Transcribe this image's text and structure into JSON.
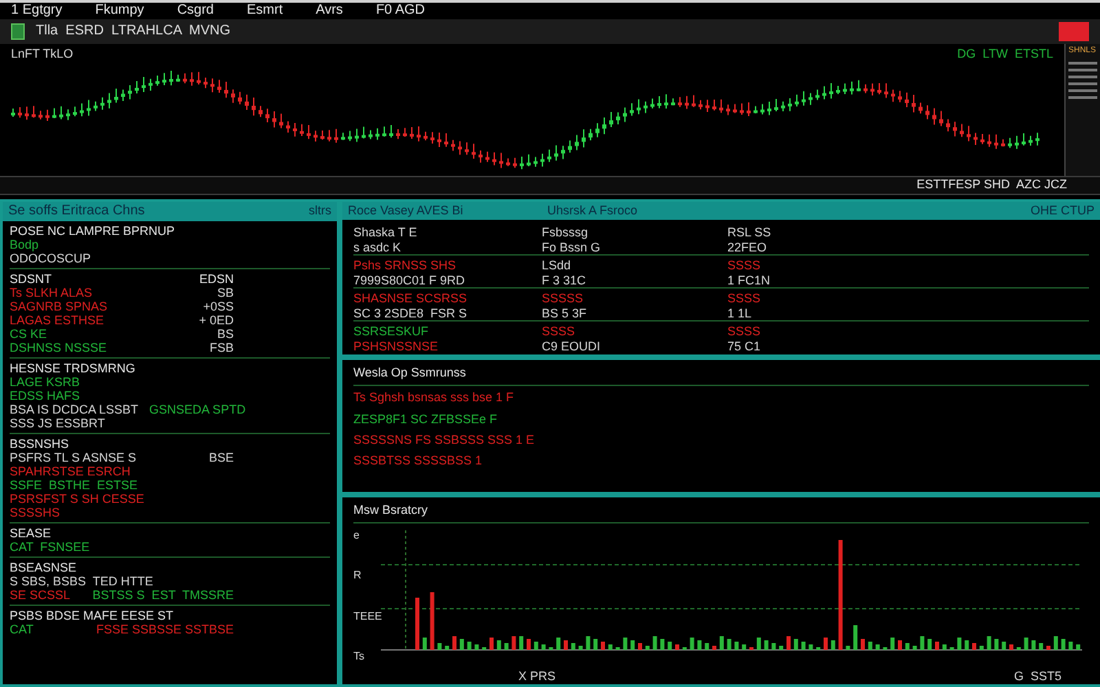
{
  "menu_bar": {
    "items": [
      "1 Egtgry",
      "Fkumpy",
      "Csgrd",
      "Esmrt",
      "Avrs",
      "F0 AGD"
    ]
  },
  "toolbar": {
    "title": "Tlla  ESRD  LTRAHLCA  MVNG"
  },
  "price_chart": {
    "label": "LnFT TkLO",
    "readout": "DG  LTW  ETSTL",
    "footer": "ESTTFESP SHD  AZC JCZ",
    "side_title": "SHNLS"
  },
  "left_panel": {
    "title": "Se soffs Eritraca Chns",
    "badge": "sltrs",
    "sections": [
      {
        "heading": "POSE NC LAMPRE BPRNUP",
        "rows": [
          {
            "cells": [
              {
                "text": "Bodp",
                "color": "#22b83a"
              }
            ]
          },
          {
            "cells": [
              {
                "text": "ODOCOSCUP",
                "color": "#d8d8d8"
              }
            ]
          }
        ]
      },
      {
        "heading": "SDSNT",
        "heading_right": "EDSN",
        "rows": [
          {
            "cells": [
              {
                "text": "Ts SLKH ALAS",
                "color": "#e02020"
              },
              {
                "text": "SB",
                "color": "#d8d8d8"
              }
            ]
          },
          {
            "cells": [
              {
                "text": "SAGNRB SPNAS",
                "color": "#e02020"
              },
              {
                "text": "+0SS",
                "color": "#d8d8d8"
              }
            ]
          },
          {
            "cells": [
              {
                "text": "LAGAS ESTHSE",
                "color": "#e02020"
              },
              {
                "text": "+ 0ED",
                "color": "#d8d8d8"
              }
            ]
          },
          {
            "cells": [
              {
                "text": "CS KE",
                "color": "#22b83a"
              },
              {
                "text": "BS",
                "color": "#d8d8d8"
              }
            ]
          },
          {
            "cells": [
              {
                "text": "DSHNSS NSSSE",
                "color": "#22b83a"
              },
              {
                "text": "FSB",
                "color": "#d8d8d8"
              }
            ]
          }
        ]
      },
      {
        "heading": "HESNSE TRDSMRNG",
        "rows": [
          {
            "cells": [
              {
                "text": "LAGE KSRB",
                "color": "#22b83a"
              }
            ]
          },
          {
            "cells": [
              {
                "text": "EDSS HAFS",
                "color": "#22b83a"
              }
            ]
          },
          {
            "cells": [
              {
                "text": "BSA IS DCDCA LSSBT",
                "color": "#d8d8d8"
              },
              {
                "text": "GSNSEDA SPTD",
                "color": "#22b83a"
              }
            ]
          },
          {
            "cells": [
              {
                "text": "SSS JS ESSBRT",
                "color": "#d8d8d8"
              }
            ]
          }
        ]
      },
      {
        "heading": "BSSNSHS",
        "rows": [
          {
            "cells": [
              {
                "text": "PSFRS TL S ASNSE S",
                "color": "#d8d8d8"
              },
              {
                "text": "BSE",
                "color": "#d8d8d8"
              }
            ]
          },
          {
            "cells": [
              {
                "text": "SPAHRSTSE ESRCH",
                "color": "#e02020"
              }
            ]
          },
          {
            "cells": [
              {
                "text": "SSFE  BSTHE  ESTSE",
                "color": "#22b83a"
              }
            ]
          },
          {
            "cells": [
              {
                "text": "PSRSFST S SH CESSE",
                "color": "#e02020"
              }
            ]
          },
          {
            "cells": [
              {
                "text": "SSSSHS",
                "color": "#e02020"
              }
            ]
          }
        ]
      },
      {
        "heading": "SEASE",
        "rows": [
          {
            "cells": [
              {
                "text": "CAT  FSNSEE",
                "color": "#22b83a"
              }
            ]
          }
        ]
      },
      {
        "heading": "BSEASNSE",
        "rows": [
          {
            "cells": [
              {
                "text": "S SBS, BSBS  TED HTTE",
                "color": "#d8d8d8"
              }
            ]
          },
          {
            "cells": [
              {
                "text": "SE SCSSL",
                "color": "#e02020"
              },
              {
                "text": "BSTSS S  EST  TMSSRE",
                "color": "#22b83a"
              }
            ]
          }
        ]
      },
      {
        "heading": "PSBS BDSE MAFE  EESE  ST",
        "rows": [
          {
            "cells": [
              {
                "text": "CAT",
                "color": "#22b83a"
              },
              {
                "text": "FSSE SSBSSE SSTBSE",
                "color": "#e02020"
              }
            ]
          }
        ]
      }
    ]
  },
  "quotes_panel": {
    "titles": [
      "Roce Vasey  AVES Bi",
      "Uhsrsk A Fsroco"
    ],
    "badge": "OHE CTUP",
    "rows": [
      {
        "cells": [
          {
            "text": "Shaska T E",
            "color": "#d8d8d8"
          },
          {
            "text": "Fsbsssg",
            "color": "#d8d8d8"
          },
          {
            "text": "RSL SS",
            "color": "#d8d8d8"
          }
        ]
      },
      {
        "cells": [
          {
            "text": "s asdc K",
            "color": "#d8d8d8"
          },
          {
            "text": "Fo Bssn G",
            "color": "#d8d8d8"
          },
          {
            "text": "22FEO",
            "color": "#d8d8d8"
          }
        ]
      },
      {
        "cells": [
          {
            "text": "Pshs SRNSS SHS",
            "color": "#e02020"
          },
          {
            "text": "LSdd",
            "color": "#d8d8d8"
          },
          {
            "text": "SSSS",
            "color": "#e02020"
          }
        ]
      },
      {
        "cells": [
          {
            "text": "7999S80C01 F 9RD",
            "color": "#d8d8d8"
          },
          {
            "text": "F 3 31C",
            "color": "#d8d8d8"
          },
          {
            "text": "1 FC1N",
            "color": "#d8d8d8"
          }
        ]
      },
      {
        "cells": [
          {
            "text": "SHASNSE SCSRSS",
            "color": "#e02020"
          },
          {
            "text": "SSSSS",
            "color": "#e02020"
          },
          {
            "text": "SSSS",
            "color": "#e02020"
          }
        ]
      },
      {
        "cells": [
          {
            "text": "SC 3 2SDE8  FSR S",
            "color": "#d8d8d8"
          },
          {
            "text": "BS 5 3F",
            "color": "#d8d8d8"
          },
          {
            "text": "1 1L",
            "color": "#d8d8d8"
          }
        ]
      },
      {
        "cells": [
          {
            "text": "SSRSESKUF",
            "color": "#22b83a"
          },
          {
            "text": "SSSS",
            "color": "#e02020"
          },
          {
            "text": "SSSS",
            "color": "#e02020"
          }
        ]
      },
      {
        "cells": [
          {
            "text": "PSHSNSSNSE",
            "color": "#e02020"
          },
          {
            "text": "C9 EOUDI",
            "color": "#d8d8d8"
          },
          {
            "text": "75 C1",
            "color": "#d8d8d8"
          }
        ]
      }
    ]
  },
  "summary_panel": {
    "title": "Wesla Op Ssmrunss",
    "rows": [
      {
        "text": "Ts Sghsh bsnsas sss bse 1 F",
        "color": "#e02020"
      },
      {
        "text": "ZESP8F1 SC ZFBSSEe F",
        "color": "#22b83a"
      },
      {
        "text": "SSSSSNS FS SSBSSS SSS 1 E",
        "color": "#e02020"
      },
      {
        "text": "SSSBTSS SSSSBSS 1",
        "color": "#e02020"
      }
    ]
  },
  "volume_panel": {
    "title": "Msw Bsratcry",
    "y_labels": [
      "e",
      "R",
      "TEEE",
      "Ts"
    ],
    "x_label": "X PRS",
    "x_label_right": "G  SST5"
  }
}
